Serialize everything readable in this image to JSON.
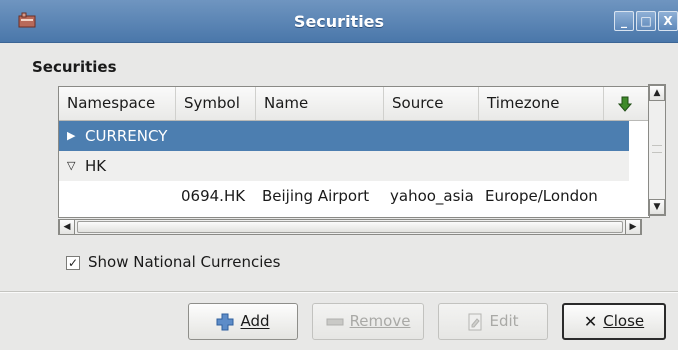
{
  "window": {
    "title": "Securities",
    "minimize_label": "_",
    "maximize_label": "□",
    "close_label": "X"
  },
  "section_title": "Securities",
  "table": {
    "columns": [
      "Namespace",
      "Symbol",
      "Name",
      "Source",
      "Timezone"
    ],
    "sort_icon": "green-down-arrow",
    "groups": [
      {
        "label": "CURRENCY",
        "expanded": false,
        "selected": true
      },
      {
        "label": "HK",
        "expanded": true,
        "selected": false
      }
    ],
    "rows": [
      {
        "namespace": "",
        "symbol": "0694.HK",
        "name": "Beijing Airport",
        "source": "yahoo_asia",
        "timezone": "Europe/London"
      }
    ]
  },
  "show_national_currencies": {
    "label": "Show National Currencies",
    "checked": true
  },
  "buttons": {
    "add": "Add",
    "remove": "Remove",
    "edit": "Edit",
    "close": "Close"
  },
  "colors": {
    "titlebar": "#4a77aa",
    "selection": "#4c7eb0",
    "add_icon": "#2f5f9e",
    "sort_icon": "#3f8a2a"
  }
}
